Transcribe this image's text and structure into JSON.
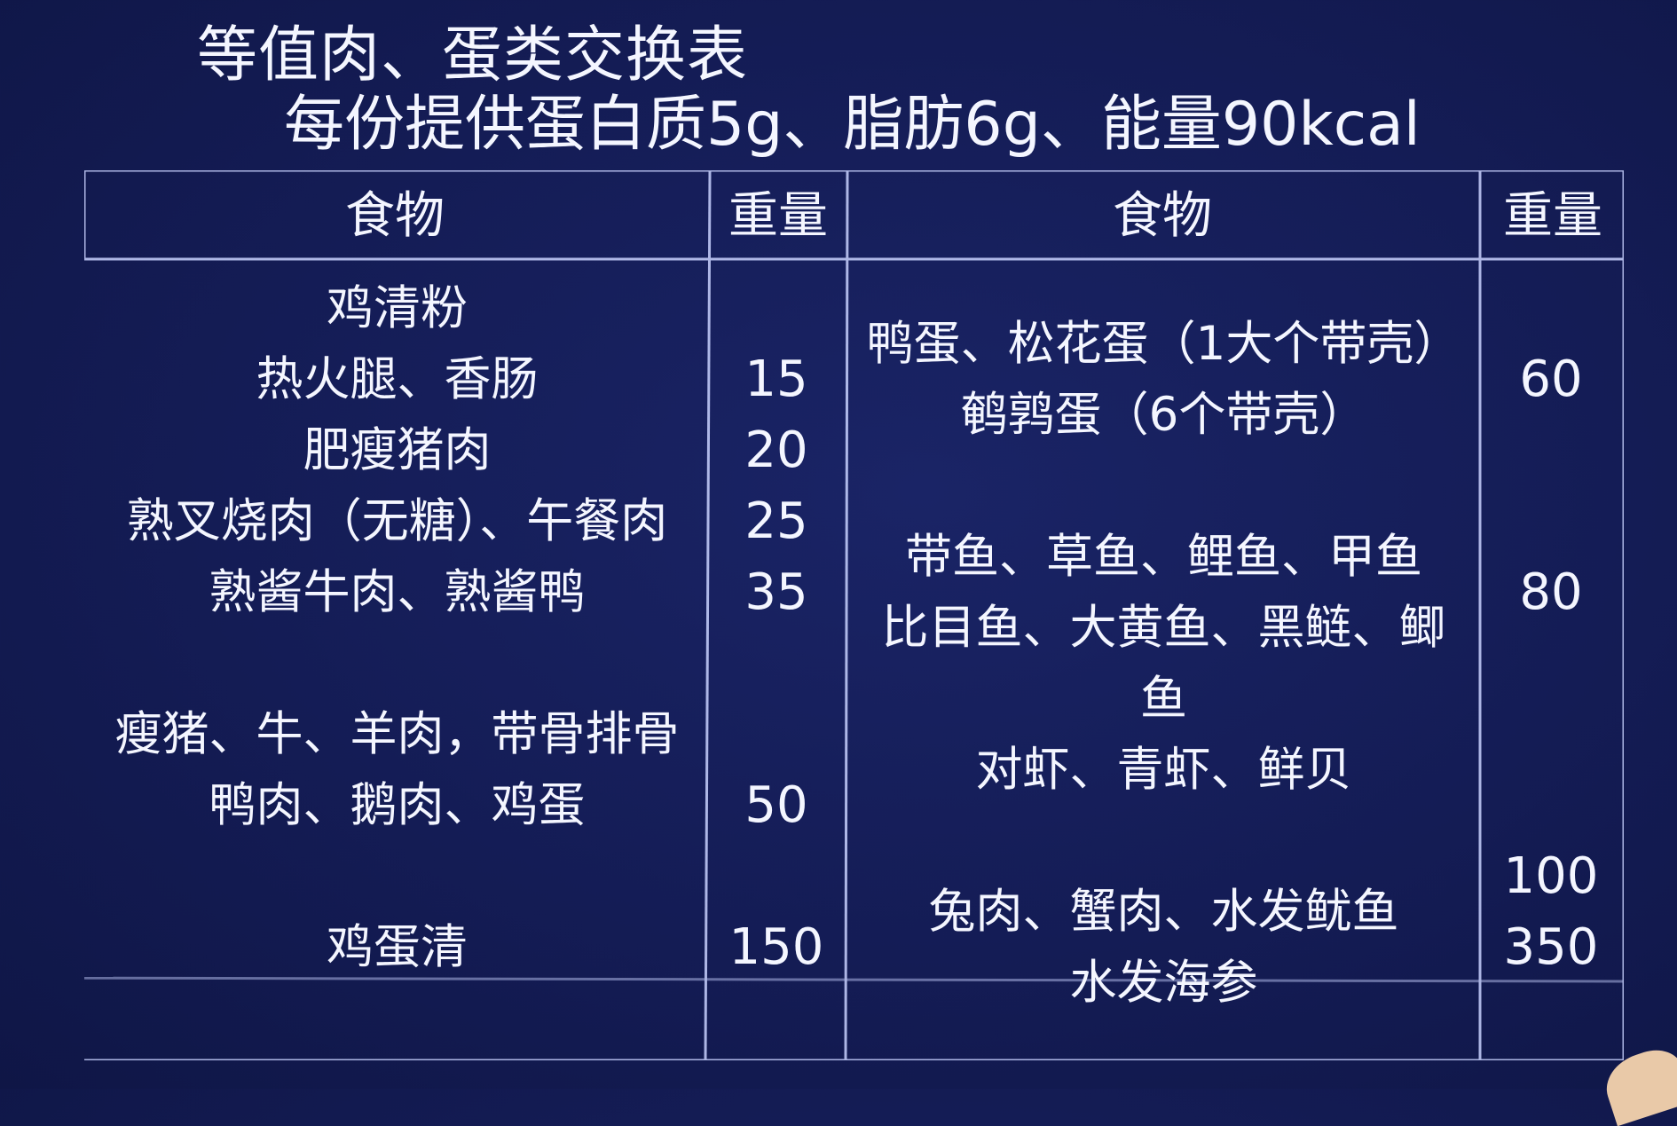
{
  "title": "等值肉、蛋类交换表",
  "subtitle": "每份提供蛋白质5g、脂肪6g、能量90kcal",
  "headers": {
    "food_left": "食物",
    "weight_left": "重量",
    "food_right": "食物",
    "weight_right": "重量"
  },
  "left": {
    "foods": [
      "鸡清粉",
      "热火腿、香肠",
      "肥瘦猪肉",
      "熟叉烧肉（无糖）、午餐肉",
      "熟酱牛肉、熟酱鸭",
      "瘦猪、牛、羊肉，带骨排骨",
      "鸭肉、鹅肉、鸡蛋",
      "鸡蛋清"
    ],
    "weights": [
      "15",
      "20",
      "25",
      "35",
      "50",
      "150"
    ]
  },
  "right": {
    "foods": [
      "鸭蛋、松花蛋（1大个带壳）",
      "鹌鹑蛋（6个带壳）",
      "带鱼、草鱼、鲤鱼、甲鱼",
      "比目鱼、大黄鱼、黑鲢、鲫",
      "鱼",
      "对虾、青虾、鲜贝",
      "兔肉、蟹肉、水发鱿鱼",
      "水发海参"
    ],
    "weights": [
      "60",
      "80",
      "100",
      "350"
    ]
  },
  "colors": {
    "background": "#141c55",
    "text": "#f4f6ff",
    "grid_line": "#c9d2ff"
  }
}
